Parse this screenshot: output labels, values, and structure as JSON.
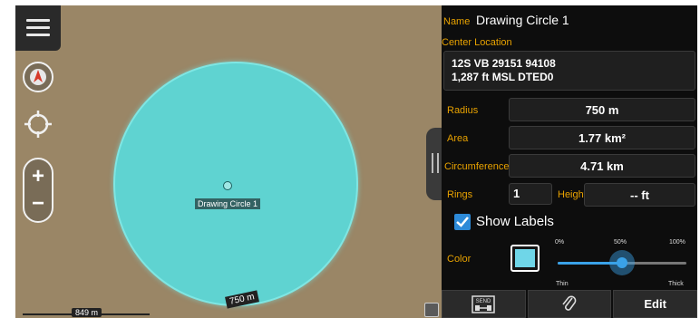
{
  "map": {
    "circle_label": "Drawing Circle 1",
    "radius_tag": "750 m",
    "scale_text": "849 m",
    "circle_color": "#5fd3d1"
  },
  "panel": {
    "name_label": "Name",
    "name_value": "Drawing Circle 1",
    "center_label": "Center Location",
    "location_line1": "12S VB 29151 94108",
    "location_line2": "1,287 ft MSL DTED0",
    "radius_label": "Radius",
    "radius_value": "750 m",
    "area_label": "Area",
    "area_value": "1.77 km²",
    "circumference_label": "Circumference",
    "circumference_value": "4.71 km",
    "rings_label": "Rings",
    "rings_value": "1",
    "height_label": "Height",
    "height_value": "-- ft",
    "show_labels": "Show Labels",
    "show_labels_checked": true,
    "color_label": "Color",
    "color_value": "#6fd6e8",
    "slider": {
      "tick_0": "0%",
      "tick_50": "50%",
      "tick_100": "100%",
      "thin": "Thin",
      "thick": "Thick",
      "value_fraction": 0.5
    },
    "toolbar": {
      "send_label": "SEND",
      "edit_label": "Edit"
    }
  },
  "colors": {
    "accent_label": "#e8a200",
    "slider_blue": "#3aa2e8",
    "map_background": "#9a8666"
  }
}
